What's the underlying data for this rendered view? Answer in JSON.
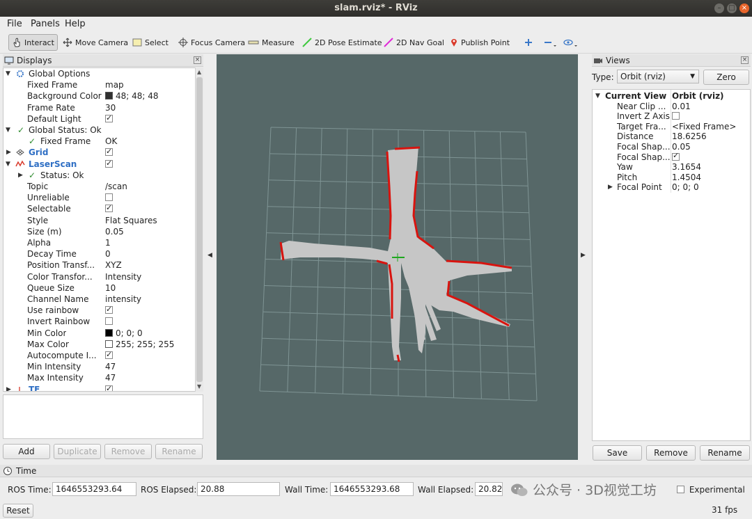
{
  "window": {
    "title": "slam.rviz* - RViz"
  },
  "menu": {
    "file": "File",
    "panels": "Panels",
    "help": "Help"
  },
  "toolbar": {
    "interact": "Interact",
    "move_camera": "Move Camera",
    "select": "Select",
    "focus_camera": "Focus Camera",
    "measure": "Measure",
    "pose_estimate": "2D Pose Estimate",
    "nav_goal": "2D Nav Goal",
    "publish_point": "Publish Point",
    "nav_goal_color": "#e02bd8",
    "pose_color": "#3fc93f",
    "publish_color": "#d93a2b"
  },
  "displays": {
    "title": "Displays",
    "rows": [
      {
        "label": "Global Options",
        "value": ""
      },
      {
        "label": "Fixed Frame",
        "value": "map"
      },
      {
        "label": "Background Color",
        "value": "48; 48; 48"
      },
      {
        "label": "Frame Rate",
        "value": "30"
      },
      {
        "label": "Default Light",
        "value": ""
      },
      {
        "label": "Global Status: Ok",
        "value": ""
      },
      {
        "label": "Fixed Frame",
        "value": "OK"
      },
      {
        "label": "Grid",
        "value": ""
      },
      {
        "label": "LaserScan",
        "value": ""
      },
      {
        "label": "Status: Ok",
        "value": ""
      },
      {
        "label": "Topic",
        "value": "/scan"
      },
      {
        "label": "Unreliable",
        "value": ""
      },
      {
        "label": "Selectable",
        "value": ""
      },
      {
        "label": "Style",
        "value": "Flat Squares"
      },
      {
        "label": "Size (m)",
        "value": "0.05"
      },
      {
        "label": "Alpha",
        "value": "1"
      },
      {
        "label": "Decay Time",
        "value": "0"
      },
      {
        "label": "Position Transf...",
        "value": "XYZ"
      },
      {
        "label": "Color Transfor...",
        "value": "Intensity"
      },
      {
        "label": "Queue Size",
        "value": "10"
      },
      {
        "label": "Channel Name",
        "value": "intensity"
      },
      {
        "label": "Use rainbow",
        "value": ""
      },
      {
        "label": "Invert Rainbow",
        "value": ""
      },
      {
        "label": "Min Color",
        "value": "0; 0; 0"
      },
      {
        "label": "Max Color",
        "value": "255; 255; 255"
      },
      {
        "label": "Autocompute I...",
        "value": ""
      },
      {
        "label": "Min Intensity",
        "value": "47"
      },
      {
        "label": "Max Intensity",
        "value": "47"
      },
      {
        "label": "TF",
        "value": ""
      }
    ],
    "buttons": {
      "add": "Add",
      "duplicate": "Duplicate",
      "remove": "Remove",
      "rename": "Rename"
    }
  },
  "views": {
    "title": "Views",
    "type_label": "Type:",
    "type_value": "Orbit (rviz)",
    "zero": "Zero",
    "rows": [
      {
        "label": "Current View",
        "value": "Orbit (rviz)"
      },
      {
        "label": "Near Clip ...",
        "value": "0.01"
      },
      {
        "label": "Invert Z Axis",
        "value": ""
      },
      {
        "label": "Target Fra...",
        "value": "<Fixed Frame>"
      },
      {
        "label": "Distance",
        "value": "18.6256"
      },
      {
        "label": "Focal Shap...",
        "value": "0.05"
      },
      {
        "label": "Focal Shap...",
        "value": ""
      },
      {
        "label": "Yaw",
        "value": "3.1654"
      },
      {
        "label": "Pitch",
        "value": "1.4504"
      },
      {
        "label": "Focal Point",
        "value": "0; 0; 0"
      }
    ],
    "buttons": {
      "save": "Save",
      "remove": "Remove",
      "rename": "Rename"
    }
  },
  "time": {
    "title": "Time",
    "ros_time_label": "ROS Time:",
    "ros_time": "1646553293.64",
    "ros_elapsed_label": "ROS Elapsed:",
    "ros_elapsed": "20.88",
    "wall_time_label": "Wall Time:",
    "wall_time": "1646553293.68",
    "wall_elapsed_label": "Wall Elapsed:",
    "wall_elapsed": "20.82",
    "experimental": "Experimental",
    "reset": "Reset",
    "fps": "31 fps"
  },
  "watermark": "公众号 · 3D视觉工坊",
  "render": {
    "background": "#566868",
    "free_space": "#c6c6c6",
    "obstacle": "#d8140f",
    "grid": "#8aa0a0"
  }
}
